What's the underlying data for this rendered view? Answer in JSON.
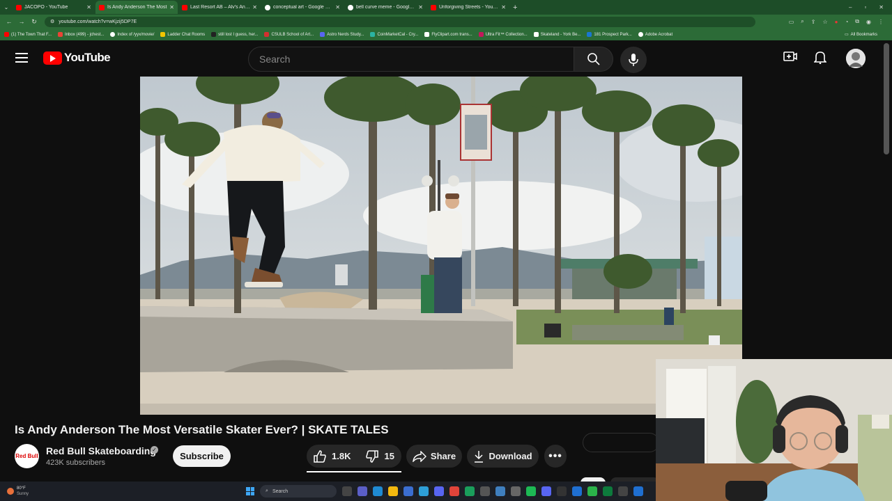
{
  "browser": {
    "tabs": [
      {
        "title": "JACOPO - YouTube",
        "icon": "youtube-icon",
        "active": false
      },
      {
        "title": "Is Andy Anderson The Most",
        "icon": "youtube-icon",
        "active": true
      },
      {
        "title": "Last Resort AB – Alv's Angels",
        "icon": "youtube-icon",
        "active": false
      },
      {
        "title": "conceptual art - Google Search",
        "icon": "google-icon",
        "active": false
      },
      {
        "title": "bell curve meme - Google Sear",
        "icon": "google-icon",
        "active": false
      },
      {
        "title": "Unforgiving Streets - YouTube",
        "icon": "youtube-icon",
        "active": false
      }
    ],
    "url": "youtube.com/watch?v=wKjzij5DP7E",
    "bookmarks": [
      {
        "label": "(1) The Town That F...",
        "color": "#ff0000"
      },
      {
        "label": "Inbox (499) - jchest...",
        "color": "#ea4335"
      },
      {
        "label": "Index of /yyx/movie/",
        "color": "#ffffff"
      },
      {
        "label": "Ladder Chat Rooms",
        "color": "#f2c500"
      },
      {
        "label": "still lost I guess, her...",
        "color": "#222222"
      },
      {
        "label": "CSULB School of Art...",
        "color": "#d32f2f"
      },
      {
        "label": "Astro Nerds Study...",
        "color": "#5865f2"
      },
      {
        "label": "CoinMarketCal - Cry...",
        "color": "#2bb3a3"
      },
      {
        "label": "FlyClipart.com trans...",
        "color": "#ffffff"
      },
      {
        "label": "Ultra Fit™ Collection...",
        "color": "#c2185b"
      },
      {
        "label": "Skateland - York Be...",
        "color": "#ffffff"
      },
      {
        "label": "181 Prospect Park...",
        "color": "#1976d2"
      },
      {
        "label": "Adobe Acrobat",
        "color": "#ffffff"
      }
    ],
    "all_bookmarks": "All Bookmarks"
  },
  "youtube": {
    "logo_text": "YouTube",
    "search_placeholder": "Search",
    "video": {
      "title": "Is Andy Anderson The Most Versatile Skater Ever? | SKATE TALES",
      "channel": "Red Bull Skateboarding",
      "channel_avatar_text": "Red Bull",
      "subscribers": "423K subscribers",
      "subscribe_label": "Subscribe",
      "likes": "1.8K",
      "dislikes": "15",
      "share_label": "Share",
      "download_label": "Download"
    }
  },
  "taskbar": {
    "temperature": "80°F",
    "weather": "Sunny",
    "search_label": "Search"
  },
  "colors": {
    "chrome_green": "#2c6b37",
    "yt_red": "#ff0000",
    "yt_bg": "#0f0f0f"
  }
}
